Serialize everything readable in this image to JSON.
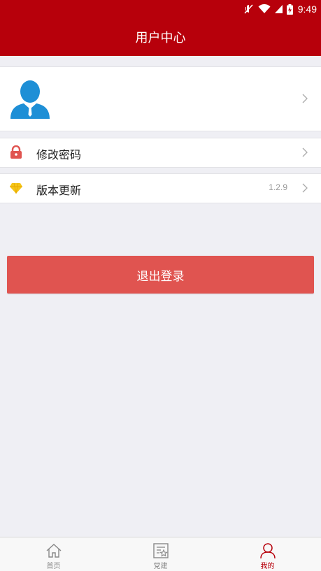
{
  "status_bar": {
    "time": "9:49"
  },
  "header": {
    "title": "用户中心"
  },
  "menu": [
    {
      "label": "修改密码",
      "value": "",
      "icon": "lock-icon"
    },
    {
      "label": "版本更新",
      "value": "1.2.9",
      "icon": "diamond-icon"
    }
  ],
  "logout": {
    "label": "退出登录"
  },
  "tabs": [
    {
      "label": "首页",
      "icon": "home-icon",
      "active": false
    },
    {
      "label": "党建",
      "icon": "document-star-icon",
      "active": false
    },
    {
      "label": "我的",
      "icon": "person-icon",
      "active": true
    }
  ],
  "colors": {
    "header": "#b7000b",
    "logout_button": "#e05450",
    "background": "#efeff4",
    "avatar": "#1e8fd6",
    "lock_icon": "#e05450",
    "diamond_icon": "#f5c518"
  }
}
